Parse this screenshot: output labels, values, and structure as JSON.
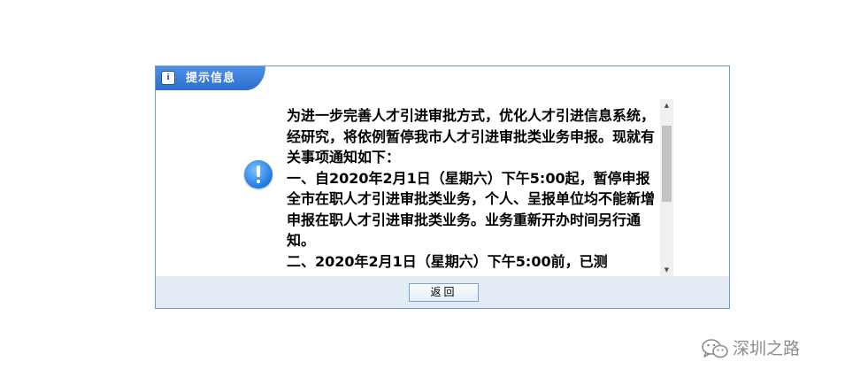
{
  "dialog": {
    "title": "提示信息",
    "message": "为进一步完善人才引进审批方式，优化人才引进信息系统，经研究，将依例暂停我市人才引进审批类业务申报。现就有关事项通知如下：\n一、自2020年2月1日（星期六）下午5:00起，暂停申报全市在职人才引进审批类业务，个人、呈报单位均不能新增申报在职人才引进审批类业务。业务重新开办时间另行通知。\n二、2020年2月1日（星期六）下午5:00前，已测",
    "return_label": "返回"
  },
  "icons": {
    "title_icon": "info-icon",
    "alert_icon": "exclamation-icon",
    "scroll_up": "scroll-up-arrow-icon",
    "scroll_down": "scroll-down-arrow-icon",
    "watermark_icon": "wechat-icon"
  },
  "colors": {
    "title_bar": "#2a6fcf",
    "dialog_border": "#6f9ad1",
    "footer": "#e3ebf4",
    "alert_icon": "#1b7ae0"
  },
  "watermark": {
    "text": "深圳之路"
  }
}
